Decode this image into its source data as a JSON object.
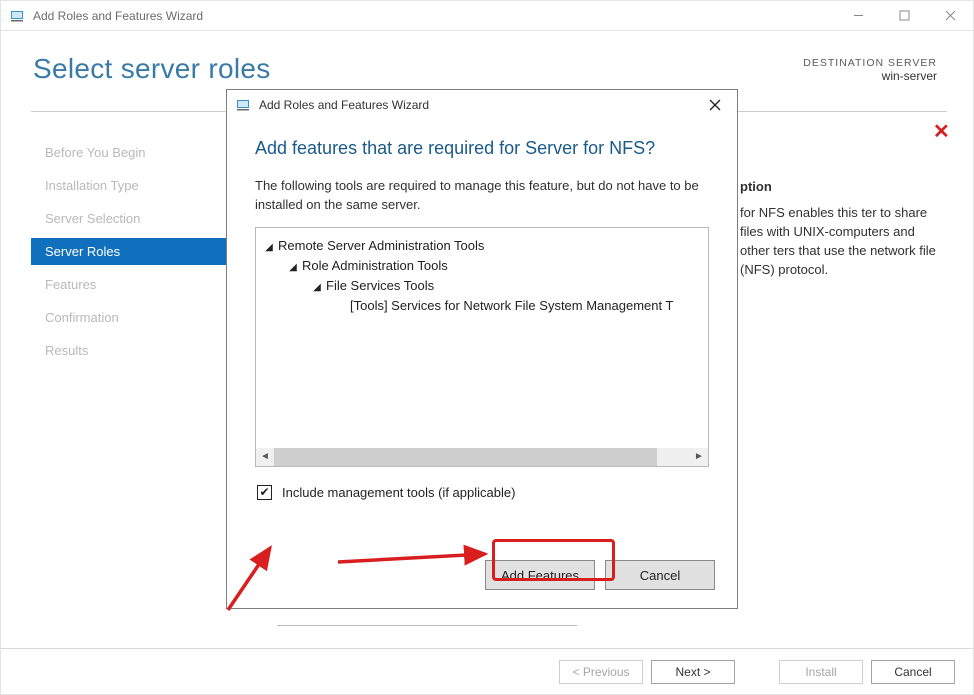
{
  "window": {
    "title": "Add Roles and Features Wizard"
  },
  "page": {
    "title": "Select server roles",
    "destination_label": "DESTINATION SERVER",
    "destination_host": "win-server"
  },
  "nav": {
    "items": [
      {
        "label": "Before You Begin"
      },
      {
        "label": "Installation Type"
      },
      {
        "label": "Server Selection"
      },
      {
        "label": "Server Roles",
        "active": true
      },
      {
        "label": "Features"
      },
      {
        "label": "Confirmation"
      },
      {
        "label": "Results"
      }
    ]
  },
  "description": {
    "heading": "ption",
    "body": "for NFS enables this ter to share files with UNIX-computers and other ters that use the network file  (NFS) protocol."
  },
  "footer": {
    "previous": "< Previous",
    "next": "Next >",
    "install": "Install",
    "cancel": "Cancel"
  },
  "modal": {
    "title": "Add Roles and Features Wizard",
    "heading": "Add features that are required for Server for NFS?",
    "description": "The following tools are required to manage this feature, but do not have to be installed on the same server.",
    "tree": {
      "l0": "Remote Server Administration Tools",
      "l1": "Role Administration Tools",
      "l2": "File Services Tools",
      "l3": "[Tools] Services for Network File System Management T"
    },
    "include_label": "Include management tools (if applicable)",
    "add_features": "Add Features",
    "cancel": "Cancel"
  }
}
